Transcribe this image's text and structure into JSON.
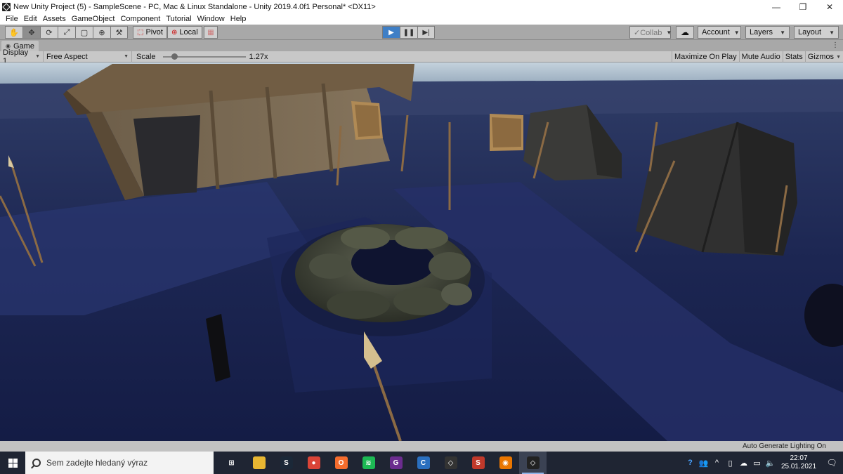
{
  "window": {
    "title": "New Unity Project (5) - SampleScene - PC, Mac & Linux Standalone - Unity 2019.4.0f1 Personal* <DX11>",
    "minimize": "—",
    "maximize": "❐",
    "close": "✕"
  },
  "menu": [
    "File",
    "Edit",
    "Assets",
    "GameObject",
    "Component",
    "Tutorial",
    "Window",
    "Help"
  ],
  "toolbar": {
    "tools": [
      "hand-tool",
      "move-tool",
      "rotate-tool",
      "scale-tool",
      "rect-tool",
      "transform-tool",
      "custom-tool"
    ],
    "active_tool_index": 1,
    "pivot_label": "Pivot",
    "local_label": "Local",
    "play_state": "playing",
    "collab_label": "Collab",
    "account_label": "Account",
    "layers_label": "Layers",
    "layout_label": "Layout"
  },
  "game_tab": {
    "label": "Game"
  },
  "game_bar": {
    "display": "Display 1",
    "aspect": "Free Aspect",
    "scale_label": "Scale",
    "scale_value": "1.27x",
    "scale_slider_fraction": 0.14,
    "maximize_on_play": "Maximize On Play",
    "mute_audio": "Mute Audio",
    "stats": "Stats",
    "gizmos": "Gizmos"
  },
  "status": {
    "lighting": "Auto Generate Lighting On"
  },
  "taskbar": {
    "search_placeholder": "Sem zadejte hledaný výraz",
    "apps": [
      {
        "name": "task-view",
        "color": "#1f2533",
        "glyph": "⊞"
      },
      {
        "name": "file-explorer",
        "color": "#e8b632",
        "glyph": ""
      },
      {
        "name": "steam",
        "color": "#1b2838",
        "glyph": "S"
      },
      {
        "name": "chrome",
        "color": "#db4437",
        "glyph": "●"
      },
      {
        "name": "origin",
        "color": "#f56c2d",
        "glyph": "O"
      },
      {
        "name": "spotify",
        "color": "#1db954",
        "glyph": "≋"
      },
      {
        "name": "gog",
        "color": "#6b2c8f",
        "glyph": "G"
      },
      {
        "name": "ccleaner",
        "color": "#2a6fbf",
        "glyph": "C"
      },
      {
        "name": "unity-hub",
        "color": "#333333",
        "glyph": "◇"
      },
      {
        "name": "substance",
        "color": "#c0392b",
        "glyph": "S"
      },
      {
        "name": "blender",
        "color": "#ea7600",
        "glyph": "◉"
      },
      {
        "name": "unity-editor",
        "color": "#222222",
        "glyph": "◇"
      }
    ],
    "active_app_index": 11,
    "time": "22:07",
    "date": "25.01.2021"
  }
}
